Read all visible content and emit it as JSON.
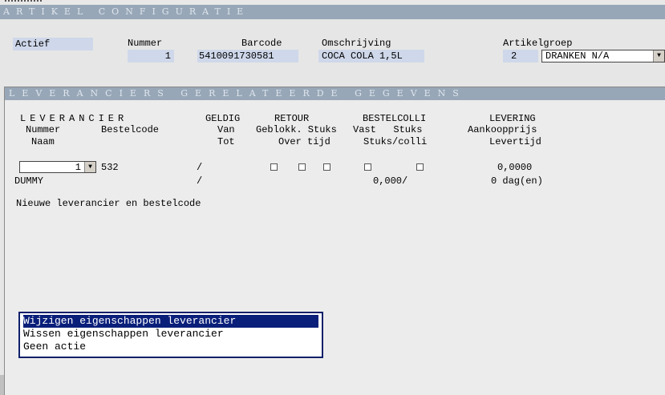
{
  "window": {
    "title": "ARTIKEL CONFIGURATIE"
  },
  "header": {
    "status_value": "Actief",
    "nummer_label": "Nummer",
    "nummer_value": "1",
    "barcode_label": "Barcode",
    "barcode_value": "5410091730581",
    "omschrijving_label": "Omschrijving",
    "omschrijving_value": "COCA COLA 1,5L",
    "artikelgroep_label": "Artikelgroep",
    "artikelgroep_nr": "2",
    "artikelgroep_selected": "DRANKEN N/A"
  },
  "panel": {
    "title": "LEVERANCIERS GERELATEERDE GEGEVENS",
    "headers": {
      "leverancier": "LEVERANCIER",
      "nummer": "Nummer",
      "bestelcode": "Bestelcode",
      "naam": "Naam",
      "geldig": "GELDIG",
      "van": "Van",
      "tot": "Tot",
      "retour": "RETOUR",
      "geblokk_stuks": "Geblokk. Stuks",
      "over_tijd": "Over tijd",
      "bestelcolli": "BESTELCOLLI",
      "vast_stuks": "Vast   Stuks",
      "stuks_colli": "Stuks/colli",
      "levering": "LEVERING",
      "aankoopprijs": "Aankoopprijs",
      "levertijd": "Levertijd"
    },
    "row": {
      "nummer": "1",
      "bestelcode": "532",
      "naam": "DUMMY",
      "van": "/",
      "tot": "/",
      "stuks_colli": "0,000/",
      "aankoopprijs": "0,0000",
      "levertijd": "0 dag(en)"
    },
    "new_line": "Nieuwe leverancier en bestelcode"
  },
  "menu": {
    "items": [
      "Wijzigen eigenschappen leverancier",
      "Wissen eigenschappen leverancier",
      "Geen actie"
    ]
  }
}
